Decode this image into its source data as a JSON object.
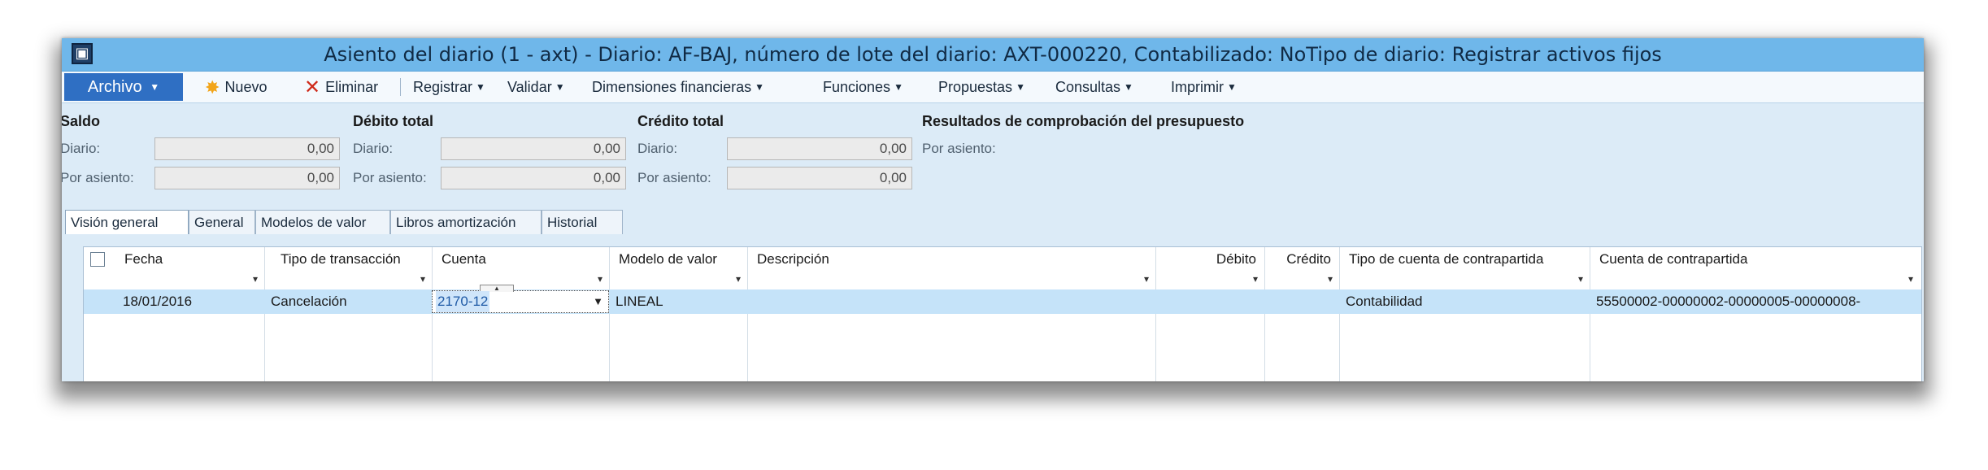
{
  "window": {
    "title": "Asiento del diario (1 - axt) - Diario: AF-BAJ, número de lote del diario: AXT-000220, Contabilizado: NoTipo de diario: Registrar activos fijos",
    "icon": "app-window-icon"
  },
  "menu": {
    "archivo": "Archivo",
    "nuevo": "Nuevo",
    "eliminar": "Eliminar",
    "registrar": "Registrar",
    "validar": "Validar",
    "dimensiones": "Dimensiones financieras",
    "funciones": "Funciones",
    "propuestas": "Propuestas",
    "consultas": "Consultas",
    "imprimir": "Imprimir",
    "caret": "▾"
  },
  "summary": {
    "saldo": {
      "heading": "Saldo",
      "diario_label": "Diario:",
      "diario_value": "0,00",
      "asiento_label": "Por asiento:",
      "asiento_value": "0,00"
    },
    "debito": {
      "heading": "Débito total",
      "diario_label": "Diario:",
      "diario_value": "0,00",
      "asiento_label": "Por asiento:",
      "asiento_value": "0,00"
    },
    "credito": {
      "heading": "Crédito total",
      "diario_label": "Diario:",
      "diario_value": "0,00",
      "asiento_label": "Por asiento:",
      "asiento_value": "0,00"
    },
    "presupuesto": {
      "heading": "Resultados de comprobación del presupuesto",
      "por_asiento_label": "Por asiento:"
    }
  },
  "tabs": [
    {
      "label": "Visión general",
      "active": true
    },
    {
      "label": "General",
      "active": false
    },
    {
      "label": "Modelos de valor",
      "active": false
    },
    {
      "label": "Libros amortización",
      "active": false
    },
    {
      "label": "Historial",
      "active": false
    }
  ],
  "grid": {
    "columns": {
      "fecha": "Fecha",
      "tipo_transaccion": "Tipo de transacción",
      "cuenta": "Cuenta",
      "modelo_valor": "Modelo de valor",
      "descripcion": "Descripción",
      "debito": "Débito",
      "credito": "Crédito",
      "tipo_cuenta_contrapartida": "Tipo de cuenta de contrapartida",
      "cuenta_contrapartida": "Cuenta de contrapartida"
    },
    "filter_arrow": "▾",
    "rows": [
      {
        "fecha": "18/01/2016",
        "tipo_transaccion": "Cancelación",
        "cuenta": "2170-12",
        "modelo_valor": "LINEAL",
        "descripcion": "",
        "debito": "",
        "credito": "",
        "tipo_cuenta_contrapartida": "Contabilidad",
        "cuenta_contrapartida": "55500002-00000002-00000005-00000008-"
      }
    ]
  },
  "colors": {
    "titlebar": "#6fb7ea",
    "archivo_button": "#2f6fc3",
    "window_bg": "#dcebf7",
    "selected_row": "#c5e3f9"
  }
}
